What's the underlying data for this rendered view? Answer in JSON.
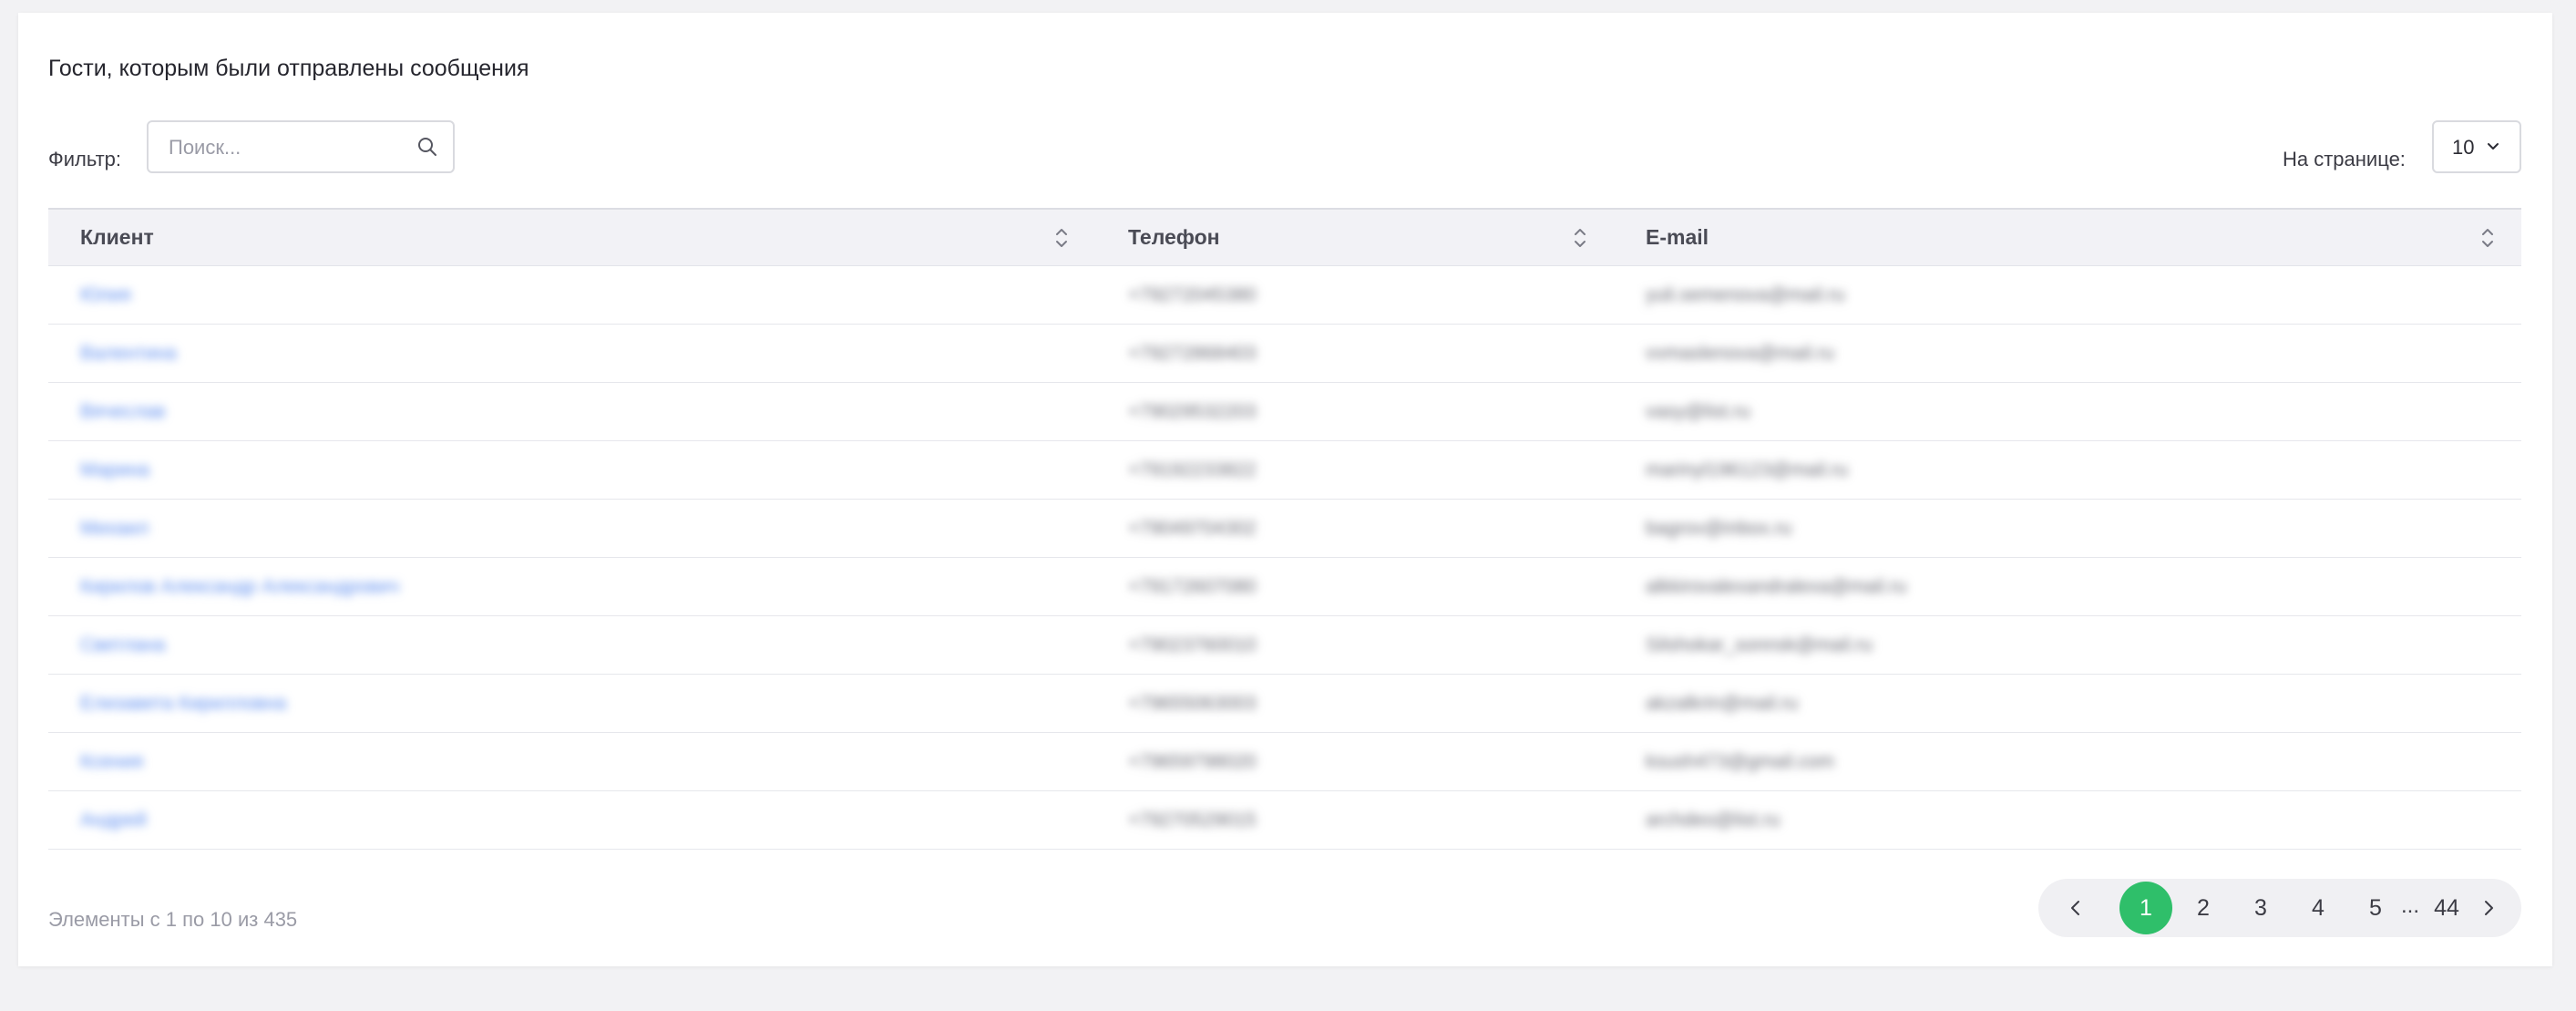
{
  "title": "Гости, которым были отправлены сообщения",
  "filter": {
    "label": "Фильтр:",
    "placeholder": "Поиск...",
    "value": ""
  },
  "per_page": {
    "label": "На странице:",
    "value": "10"
  },
  "table": {
    "columns": [
      "Клиент",
      "Телефон",
      "E-mail"
    ],
    "rows": [
      {
        "client": "Юлия",
        "phone": "+79272045380",
        "email": "yuli.semenova@mail.ru"
      },
      {
        "client": "Валентина",
        "phone": "+79272868403",
        "email": "vvmaslenova@mail.ru"
      },
      {
        "client": "Вячеслав",
        "phone": "+79029532203",
        "email": "vasy@list.ru"
      },
      {
        "client": "Марина",
        "phone": "+79192233822",
        "email": "marinyl196123@mail.ru"
      },
      {
        "client": "Михаил",
        "phone": "+79049704302",
        "email": "bagrov@inbox.ru"
      },
      {
        "client": "Кирилов Александр Александрович",
        "phone": "+79172607080",
        "email": "alkkirovalexandralexa@mail.ru"
      },
      {
        "client": "Светлана",
        "phone": "+79023760010",
        "email": "Silshokar_sonnsk@mail.ru"
      },
      {
        "client": "Елизавета Кирилловна",
        "phone": "+79655063003",
        "email": "akzalkrin@mail.ru"
      },
      {
        "client": "Ксения",
        "phone": "+79659798020",
        "email": "ksush473@gmail.com"
      },
      {
        "client": "Андрей",
        "phone": "+79270529015",
        "email": "archdeo@list.ru"
      }
    ]
  },
  "summary": "Элементы с 1 по 10 из 435",
  "pagination": {
    "pages": [
      "1",
      "2",
      "3",
      "4",
      "5"
    ],
    "ellipsis": "...",
    "last": "44",
    "active": "1"
  },
  "colors": {
    "accent": "#2fbf6a",
    "link": "#5b8cf0"
  },
  "icons": {
    "search": "search-icon",
    "sort": "sort-icon",
    "chevron": "chevron-down-icon",
    "prev": "chevron-left-icon",
    "next": "chevron-right-icon"
  }
}
